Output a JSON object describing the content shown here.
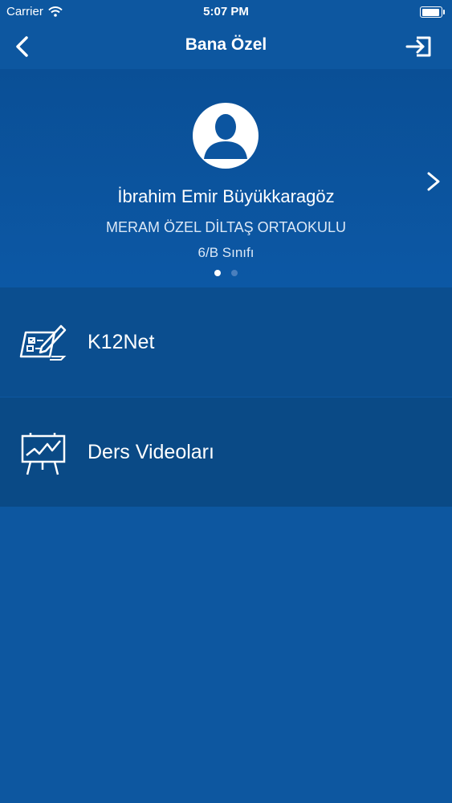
{
  "status_bar": {
    "carrier": "Carrier",
    "time": "5:07 PM"
  },
  "nav": {
    "title": "Bana Özel"
  },
  "profile": {
    "name": "İbrahim Emir Büyükkaragöz",
    "school": "MERAM ÖZEL DİLTAŞ ORTAOKULU",
    "class": "6/B Sınıfı",
    "page_count": 2,
    "current_page": 1
  },
  "menu": [
    {
      "label": "K12Net",
      "icon": "k12net-icon"
    },
    {
      "label": "Ders Videoları",
      "icon": "presentation-chart-icon"
    }
  ],
  "colors": {
    "background": "#0d57a0",
    "row1": "#0b4e8f",
    "row2": "#0a4a86",
    "text": "#ffffff"
  }
}
